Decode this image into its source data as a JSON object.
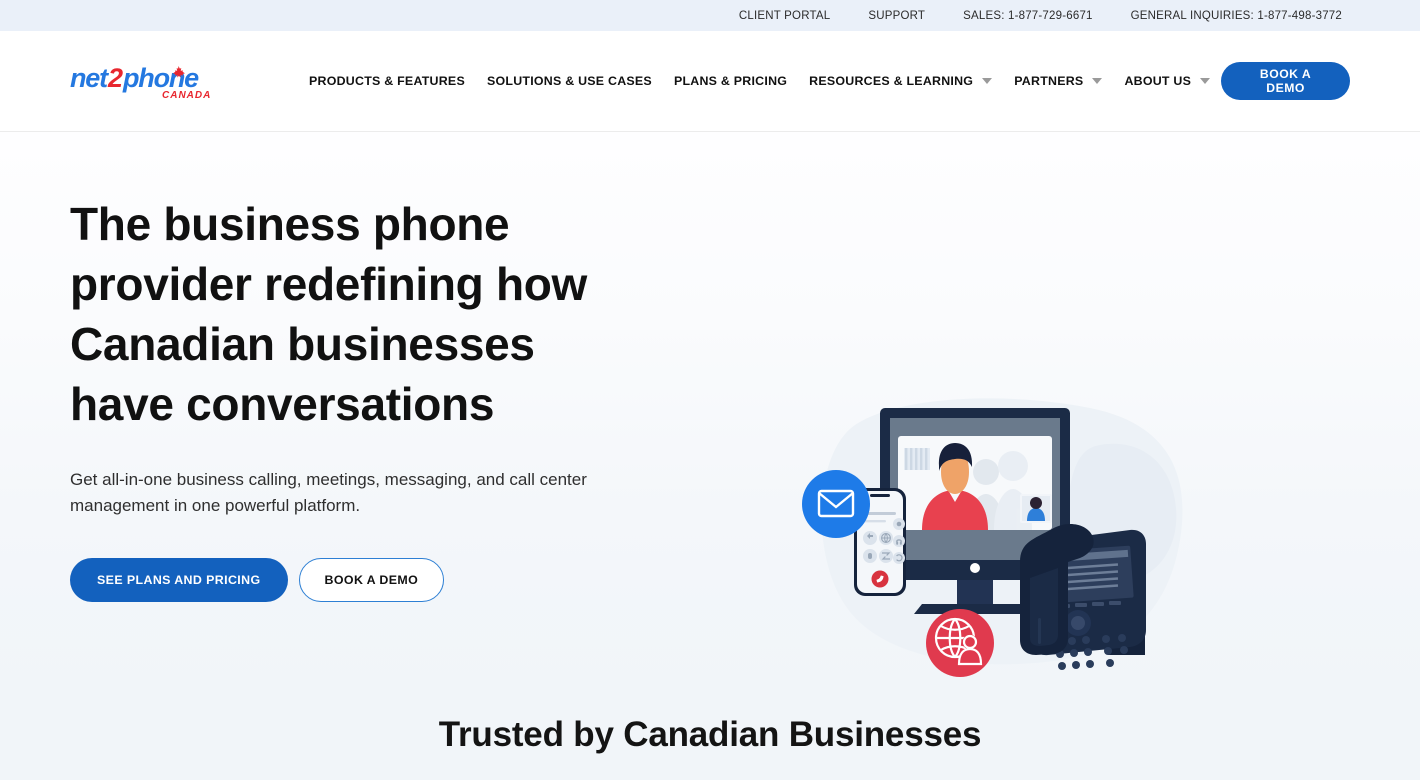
{
  "topbar": {
    "links": [
      {
        "label": "CLIENT PORTAL"
      },
      {
        "label": "SUPPORT"
      },
      {
        "label": "SALES: 1-877-729-6671"
      },
      {
        "label": "GENERAL INQUIRIES: 1-877-498-3772"
      }
    ]
  },
  "header": {
    "logo": {
      "part1": "net",
      "part2": "2",
      "part3": "phone",
      "tagline": "CANADA",
      "color_blue": "#2478e0",
      "color_red": "#e8272f"
    },
    "nav": [
      {
        "label": "PRODUCTS & FEATURES",
        "has_caret": false
      },
      {
        "label": "SOLUTIONS & USE CASES",
        "has_caret": false
      },
      {
        "label": "PLANS & PRICING",
        "has_caret": false
      },
      {
        "label": "RESOURCES & LEARNING",
        "has_caret": true
      },
      {
        "label": "PARTNERS",
        "has_caret": true
      },
      {
        "label": "ABOUT US",
        "has_caret": true
      }
    ],
    "cta_label": "BOOK A DEMO"
  },
  "hero": {
    "title": "The business phone provider redefining how Canadian businesses have conversations",
    "subtitle": "Get all-in-one business calling, meetings, messaging, and call center management in one powerful platform.",
    "primary_button": "SEE PLANS AND PRICING",
    "secondary_button": "BOOK A DEMO",
    "illustration": {
      "name": "unified-communications-devices",
      "badges": [
        {
          "name": "email-badge",
          "icon": "envelope-icon",
          "color": "#1e7be8"
        },
        {
          "name": "global-contact-badge",
          "icon": "globe-person-icon",
          "color": "#e03a4e"
        }
      ],
      "devices": [
        "desktop-monitor-video-call",
        "smartphone-call-screen",
        "desk-ip-phone"
      ]
    }
  },
  "trusted": {
    "title": "Trusted by Canadian Businesses"
  },
  "colors": {
    "brand_blue": "#1361be",
    "brand_red": "#e8272f",
    "topbar_bg": "#eaf0f9",
    "hero_bg_bottom": "#f1f5f9",
    "navy": "#1b2b46"
  }
}
